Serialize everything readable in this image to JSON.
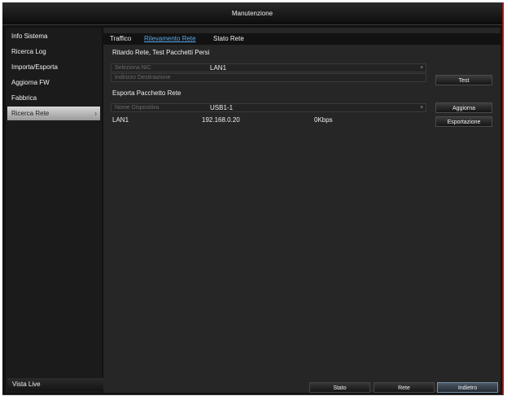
{
  "window": {
    "title": "Manutenzione"
  },
  "sidebar": {
    "items": [
      {
        "label": "Info Sistema"
      },
      {
        "label": "Ricerca Log"
      },
      {
        "label": "Importa/Esporta"
      },
      {
        "label": "Aggiorna FW"
      },
      {
        "label": "Fabbrica"
      },
      {
        "label": "Ricerca Rete",
        "chevron": "›"
      }
    ],
    "live_view": "Vista Live"
  },
  "tabs": [
    {
      "label": "Traffico"
    },
    {
      "label": "Rilevamento Rete",
      "active": true
    },
    {
      "label": "Stato Rete"
    }
  ],
  "test_section": {
    "title": "Ritardo Rete, Test Pacchetti Persi",
    "nic_label": "Seleziona NIC",
    "nic_value": "LAN1",
    "dest_label": "Indirizzo Destinazione",
    "dest_value": "",
    "test_button": "Test"
  },
  "export_section": {
    "title": "Esporta Pacchetto Rete",
    "device_label": "Nome Dispositivo",
    "device_value": "USB1-1",
    "refresh_button": "Aggiorna",
    "export_button": "Esportazione",
    "row": {
      "interface": "LAN1",
      "ip": "192.168.0.20",
      "rate": "0Kbps"
    }
  },
  "footer": {
    "buttons": [
      {
        "label": "Stato"
      },
      {
        "label": "Rete"
      },
      {
        "label": "Indietro",
        "primary": true
      }
    ]
  },
  "colors": {
    "accent_tab": "#5aa8e8",
    "window_bg": "#121212",
    "panel_bg": "#262626",
    "border_right": "#8b1a1a"
  }
}
